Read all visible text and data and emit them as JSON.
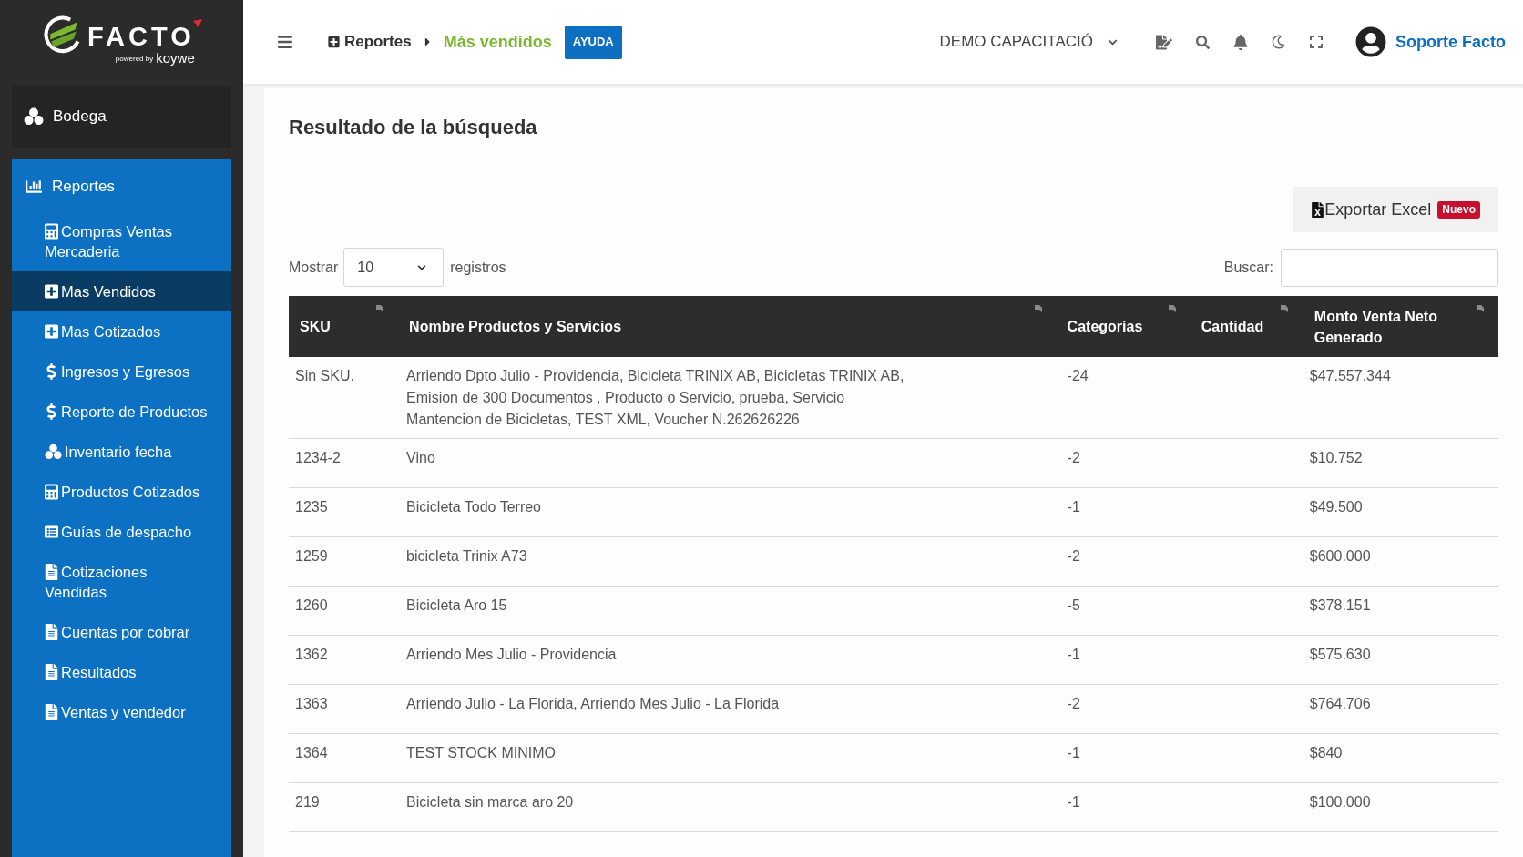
{
  "brand": {
    "name": "FACTO",
    "tagline": "powered by",
    "partner": "koywe"
  },
  "sidebar": {
    "items": [
      {
        "label": "Bodega",
        "expanded": false
      },
      {
        "label": "Reportes",
        "expanded": true,
        "children": [
          {
            "label": "Compras Ventas Mercaderia",
            "selected": false
          },
          {
            "label": "Mas Vendidos",
            "selected": true
          },
          {
            "label": "Mas Cotizados",
            "selected": false
          },
          {
            "label": "Ingresos y Egresos",
            "selected": false
          },
          {
            "label": "Reporte de Productos",
            "selected": false
          },
          {
            "label": "Inventario fecha",
            "selected": false
          },
          {
            "label": "Productos Cotizados",
            "selected": false
          },
          {
            "label": "Guías de despacho",
            "selected": false
          },
          {
            "label": "Cotizaciones Vendidas",
            "selected": false
          },
          {
            "label": "Cuentas por cobrar",
            "selected": false
          },
          {
            "label": "Resultados",
            "selected": false
          },
          {
            "label": "Ventas y vendedor",
            "selected": false
          }
        ]
      }
    ]
  },
  "header": {
    "breadcrumb": [
      {
        "label": "Reportes",
        "current": false
      },
      {
        "label": "Más vendidos",
        "current": true
      }
    ],
    "help_button": "AYUDA",
    "company_selector": "DEMO CAPACITACIÓ",
    "user_name": "Soporte Facto"
  },
  "page": {
    "title": "Resultado de la búsqueda",
    "export_button": {
      "label": "Exportar Excel",
      "badge": "Nuevo"
    },
    "length_menu": {
      "prefix": "Mostrar",
      "value": "10",
      "suffix": "registros"
    },
    "search": {
      "label": "Buscar:"
    }
  },
  "table": {
    "columns": [
      "SKU",
      "Nombre Productos y Servicios",
      "Categorías",
      "Cantidad",
      "Monto Venta Neto Generado"
    ],
    "rows": [
      {
        "sku": "Sin SKU.",
        "nombre": "Arriendo Dpto Julio - Providencia, Bicicleta TRINIX AB, Bicicletas TRINIX AB, Emision de 300 Documentos , Producto o Servicio, prueba, Servicio Mantencion de Bicicletas, TEST XML, Voucher N.262626226",
        "categorias": "-24",
        "monto": "$47.557.344"
      },
      {
        "sku": "1234-2",
        "nombre": "Vino",
        "categorias": "-2",
        "monto": "$10.752"
      },
      {
        "sku": "1235",
        "nombre": "Bicicleta Todo Terreo",
        "categorias": "-1",
        "monto": "$49.500"
      },
      {
        "sku": "1259",
        "nombre": "bicicleta Trinix A73",
        "categorias": "-2",
        "monto": "$600.000"
      },
      {
        "sku": "1260",
        "nombre": "Bicicleta Aro 15",
        "categorias": "-5",
        "monto": "$378.151"
      },
      {
        "sku": "1362",
        "nombre": "Arriendo Mes Julio - Providencia",
        "categorias": "-1",
        "monto": "$575.630"
      },
      {
        "sku": "1363",
        "nombre": "Arriendo Julio - La Florida, Arriendo Mes Julio - La Florida",
        "categorias": "-2",
        "monto": "$764.706"
      },
      {
        "sku": "1364",
        "nombre": "TEST STOCK MINIMO",
        "categorias": "-1",
        "monto": "$840"
      },
      {
        "sku": "219",
        "nombre": "Bicicleta sin marca aro 20",
        "categorias": "-1",
        "monto": "$100.000"
      }
    ]
  }
}
